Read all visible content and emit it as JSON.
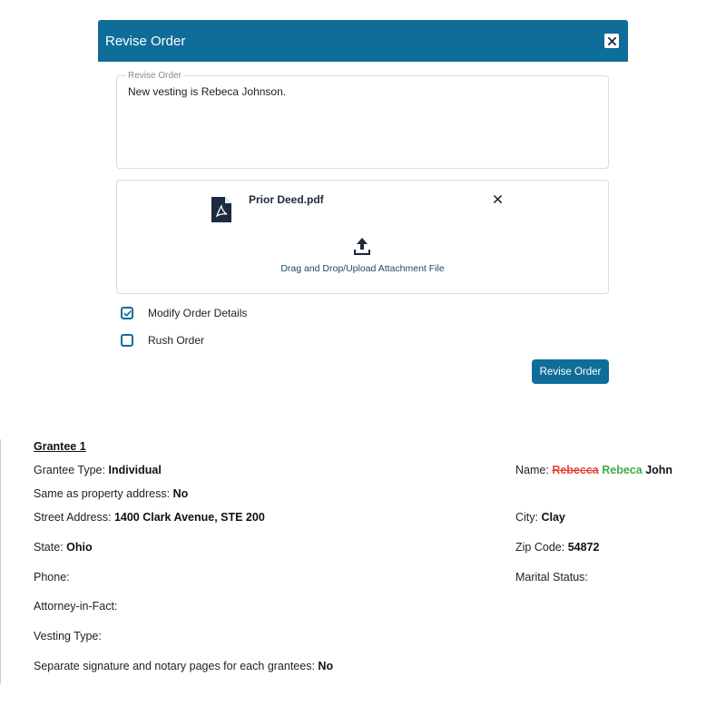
{
  "modal": {
    "title": "Revise Order",
    "fieldset_legend": "Revise Order",
    "revision_text": "New vesting is Rebeca Johnson.",
    "attachment": {
      "file_name": "Prior Deed.pdf",
      "upload_text": "Drag and Drop/Upload Attachment File"
    },
    "options": [
      {
        "label": "Modify Order Details",
        "checked": true
      },
      {
        "label": "Rush Order",
        "checked": false
      }
    ],
    "submit_label": "Revise Order"
  },
  "grantee": {
    "title": "Grantee 1",
    "type_label": "Grantee Type:",
    "type_value": "Individual",
    "same_address_label": "Same as property address:",
    "same_address_value": "No",
    "street_label": "Street Address:",
    "street_value": "1400 Clark Avenue, STE 200",
    "state_label": "State:",
    "state_value": "Ohio",
    "phone_label": "Phone:",
    "attorney_label": "Attorney-in-Fact:",
    "vesting_label": "Vesting Type:",
    "separate_label": "Separate signature and notary pages for each grantees:",
    "separate_value": "No",
    "name_label": "Name:",
    "name_removed": "Rebecca",
    "name_added": "Rebeca",
    "name_last": "John",
    "city_label": "City:",
    "city_value": "Clay",
    "zip_label": "Zip Code:",
    "zip_value": "54872",
    "marital_label": "Marital Status:"
  },
  "colors": {
    "primary": "#0f6d9a",
    "removed": "#e0493a",
    "added": "#3cb04a"
  }
}
